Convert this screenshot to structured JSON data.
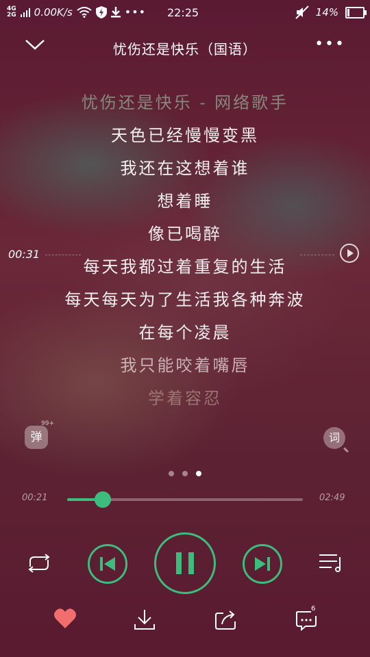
{
  "status_bar": {
    "network_top": "4G",
    "network_bottom": "2G",
    "speed": "0.00K/s",
    "time": "22:25",
    "battery": "14%",
    "battery_level": 0.14
  },
  "header": {
    "title": "忧伤还是快乐（国语）"
  },
  "lyrics": [
    "忧伤还是快乐 - 网络歌手",
    "天色已经慢慢变黑",
    "我还在这想着谁",
    "想着睡",
    "像已喝醉",
    "每天我都过着重复的生活",
    "每天每天为了生活我各种奔波",
    "在每个凌晨",
    "我只能咬着嘴唇",
    "学着容忍"
  ],
  "seek_indicator": {
    "time": "00:31"
  },
  "danmu": {
    "label": "弹",
    "count": "99+"
  },
  "lyric_search": {
    "label": "词"
  },
  "pager": {
    "total": 3,
    "active_index": 2
  },
  "progress": {
    "current": "00:21",
    "total": "02:49",
    "fraction": 0.15
  },
  "colors": {
    "accent": "#3dbd7d",
    "heart": "#f26e6e"
  },
  "icons": {
    "repeat": "repeat-icon",
    "prev": "skip-previous-icon",
    "pause": "pause-icon",
    "next": "skip-next-icon",
    "playlist": "playlist-icon",
    "like": "heart-icon",
    "download": "download-icon",
    "share": "share-icon",
    "comment": "comment-icon"
  },
  "comment_count": "6"
}
